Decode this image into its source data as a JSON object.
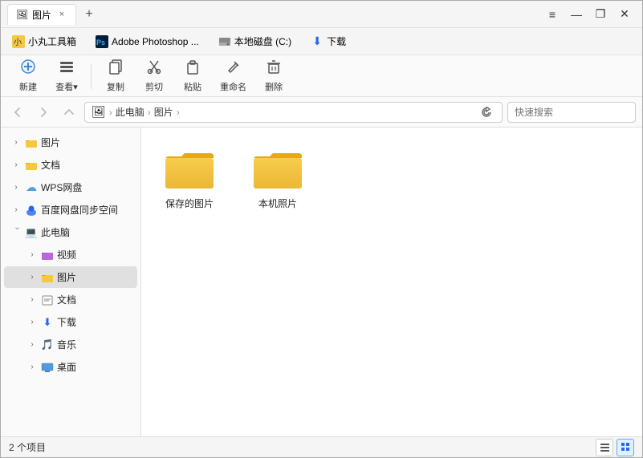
{
  "window": {
    "title": "图片",
    "tab_label": "图片",
    "tab_close": "×",
    "tab_new": "+",
    "controls": {
      "minimize": "—",
      "restore": "❐",
      "close": "✕",
      "menu": "≡"
    }
  },
  "pinned": {
    "items": [
      {
        "id": "xiaowantools",
        "label": "小丸工具箱",
        "icon": "⬛",
        "color": "#222"
      },
      {
        "id": "photoshop",
        "label": "Adobe Photoshop ...",
        "icon": "Ps",
        "color": "#001e36",
        "bg": "#001e36"
      },
      {
        "id": "localdisk",
        "label": "本地磁盘 (C:)",
        "icon": "💾",
        "color": "#555"
      },
      {
        "id": "download",
        "label": "下载",
        "icon": "⬇",
        "color": "#2468f2"
      }
    ]
  },
  "toolbar": {
    "buttons": [
      {
        "id": "new",
        "label": "新建",
        "icon": "+"
      },
      {
        "id": "view",
        "label": "查看▾",
        "icon": "☰"
      },
      {
        "id": "copy",
        "label": "复制",
        "icon": "⧉"
      },
      {
        "id": "cut",
        "label": "剪切",
        "icon": "✂"
      },
      {
        "id": "paste",
        "label": "粘贴",
        "icon": "📋"
      },
      {
        "id": "rename",
        "label": "重命名",
        "icon": "✏"
      },
      {
        "id": "delete",
        "label": "删除",
        "icon": "🗑"
      }
    ]
  },
  "addressbar": {
    "back_disabled": true,
    "forward_disabled": true,
    "up": "↑",
    "breadcrumb": {
      "icon": "🖼",
      "parts": [
        "此电脑",
        "图片"
      ]
    },
    "search_placeholder": "快速搜索"
  },
  "sidebar": {
    "items": [
      {
        "id": "pictures",
        "label": "图片",
        "icon": "🖼",
        "expand": ">",
        "indent": 0,
        "active": false
      },
      {
        "id": "documents",
        "label": "文档",
        "icon": "📄",
        "expand": ">",
        "indent": 0,
        "active": false
      },
      {
        "id": "wps-cloud",
        "label": "WPS网盘",
        "icon": "☁",
        "expand": ">",
        "indent": 0,
        "active": false,
        "icon_color": "#4ea0e0"
      },
      {
        "id": "baidu-cloud",
        "label": "百度网盘同步空间",
        "icon": "⬡",
        "expand": ">",
        "indent": 0,
        "active": false
      },
      {
        "id": "this-pc",
        "label": "此电脑",
        "icon": "💻",
        "expand": "∨",
        "indent": 0,
        "active": false
      },
      {
        "id": "video",
        "label": "视频",
        "icon": "▶",
        "expand": ">",
        "indent": 1,
        "active": false
      },
      {
        "id": "pictures2",
        "label": "图片",
        "icon": "🖼",
        "expand": ">",
        "indent": 1,
        "active": true
      },
      {
        "id": "documents2",
        "label": "文档",
        "icon": "📄",
        "expand": ">",
        "indent": 1,
        "active": false
      },
      {
        "id": "downloads",
        "label": "下载",
        "icon": "⬇",
        "expand": ">",
        "indent": 1,
        "active": false
      },
      {
        "id": "music",
        "label": "音乐",
        "icon": "🎵",
        "expand": ">",
        "indent": 1,
        "active": false
      },
      {
        "id": "desktop",
        "label": "桌面",
        "icon": "🖥",
        "expand": ">",
        "indent": 1,
        "active": false
      }
    ]
  },
  "content": {
    "folders": [
      {
        "id": "saved-pictures",
        "label": "保存的图片"
      },
      {
        "id": "local-photos",
        "label": "本机照片"
      }
    ]
  },
  "statusbar": {
    "text": "2 个项目",
    "view_list": "≡",
    "view_grid": "⊞"
  }
}
